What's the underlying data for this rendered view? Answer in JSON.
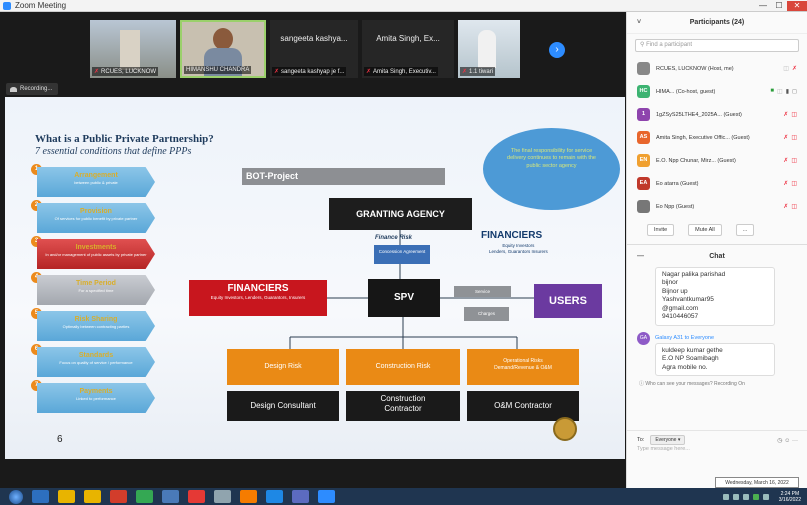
{
  "window": {
    "title": "Zoom Meeting",
    "btn_min": "—",
    "btn_max": "☐",
    "btn_close": "✕"
  },
  "thumbnails": [
    {
      "name": "RCUES, LUCKNOW"
    },
    {
      "name": "HIMANSHU CHANDRA"
    },
    {
      "display": "sangeeta kashya...",
      "name": "sangeeta kashyap je f..."
    },
    {
      "display": "Amita Singh, Ex...",
      "name": "Amita Singh, Executiv..."
    },
    {
      "name": "1.1 tiwari"
    }
  ],
  "next_icon": "›",
  "recording_label": "Recording...",
  "slide": {
    "title": "What is a Public Private Partnership?",
    "subtitle": "7 essential conditions that define PPPs",
    "conditions": [
      {
        "num": "1",
        "title": "Arrangement",
        "sub": "between public & private",
        "style": "blue"
      },
      {
        "num": "2",
        "title": "Provision",
        "sub": "Of services for public benefit by private partner",
        "style": "blue"
      },
      {
        "num": "3",
        "title": "Investments",
        "sub": "In and/or management of public assets by private partner",
        "style": "red"
      },
      {
        "num": "4",
        "title": "Time Period",
        "sub": "For a specified time",
        "style": "gray"
      },
      {
        "num": "5",
        "title": "Risk Sharing",
        "sub": "Optimally between contracting parties",
        "style": "blue"
      },
      {
        "num": "6",
        "title": "Standards",
        "sub": "Focus on quality of service / performance",
        "style": "blue"
      },
      {
        "num": "7",
        "title": "Payments",
        "sub": "Linked to performance",
        "style": "blue"
      }
    ],
    "bot_label": "BOT-Project",
    "bubble_text": "The final responsibility for service delivery continues to remain with the public sector agency",
    "granting_agency": "GRANTING AGENCY",
    "finance_risk": "Finance Risk",
    "concession_agreement": "Concession Agreement",
    "financiers_right": "FINANCIERS",
    "financiers_right_sub": "Equity Investors\nLenders, Guarantors Insurers",
    "financiers_left": "FINANCIERS",
    "financiers_left_sub": "Equity Investors, Lenders, Guarantors, Insurers",
    "spv": "SPV",
    "service": "Service",
    "charges": "Charges",
    "users": "USERS",
    "risks": [
      "Design Risk",
      "Construction Risk",
      "Operational Risks\nDemand/Revenue & O&M"
    ],
    "parties": [
      "Design Consultant",
      "Construction\nContractor",
      "O&M Contractor"
    ],
    "page_number": "6"
  },
  "taskbar": {
    "time": "2:24 PM",
    "date_tooltip": "Wednesday, March 16, 2022",
    "date_short": "3/16/2022",
    "apps": [
      "#2d6fbf",
      "#e8b400",
      "#e8b400",
      "#d23d2b",
      "#34a853",
      "#4a7ab8",
      "#e53935",
      "#90a4ae",
      "#f57c00",
      "#1e88e5",
      "#5c6bc0",
      "#2d8cff"
    ]
  },
  "participants": {
    "header": "Participants (24)",
    "collapse_icon": "˅",
    "search_placeholder": "Find a participant",
    "list": [
      {
        "initials": "",
        "name": "RCUES, LUCKNOW (Host, me)",
        "color": "#888888"
      },
      {
        "initials": "HC",
        "name": "HIMA... (Co-host, guest)",
        "color": "#3cb371"
      },
      {
        "initials": "1",
        "name": "1gZSyS25LTHE4_2025A... (Guest)",
        "color": "#8e44ad"
      },
      {
        "initials": "AS",
        "name": "Amita Singh, Executive Offic... (Guest)",
        "color": "#e8662c"
      },
      {
        "initials": "EN",
        "name": "E.O. Npp Chunar, Mirz... (Guest)",
        "color": "#f0a030"
      },
      {
        "initials": "EA",
        "name": "Eo atarra (Guest)",
        "color": "#c0392b"
      },
      {
        "initials": "",
        "name": "Eo Npp (Guest)",
        "color": "#777777"
      }
    ],
    "invite": "Invite",
    "mute_all": "Mute All",
    "more": "...",
    "mic_icon": "🎤̸",
    "cam_icon": "◫̸"
  },
  "chat": {
    "header": "Chat",
    "collapse_icon": "—",
    "message1": "Nagar palika parishad\nbijnor\nBijnor up\nYashvantkumar95\n@gmail.com\n9410446057",
    "sender2_initials": "GA",
    "sender2": "Galaxy A31 to Everyone",
    "message2": "kuldeep kumar gethe\nE.O NP Soamibagh\nAgra mobile no.",
    "who_can_see": "Who can see your messages? Recording On",
    "to_label": "To:",
    "to_value": "Everyone",
    "input_placeholder": "Type message here...",
    "tools": "◷ ☺ ···"
  },
  "colors": {
    "accent": "#2d8cff",
    "danger": "#e34444",
    "orange": "#ea8a15"
  }
}
